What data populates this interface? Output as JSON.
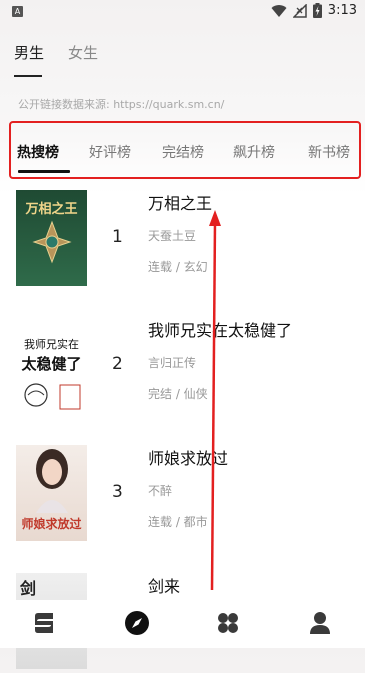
{
  "status": {
    "time": "3:13",
    "app_icon_letter": "A"
  },
  "gender_tabs": [
    {
      "label": "男生",
      "active": true
    },
    {
      "label": "女生",
      "active": false
    }
  ],
  "source_text": "公开链接数据来源: https://quark.sm.cn/",
  "rank_tabs": [
    {
      "label": "热搜榜",
      "active": true
    },
    {
      "label": "好评榜",
      "active": false
    },
    {
      "label": "完结榜",
      "active": false
    },
    {
      "label": "飙升榜",
      "active": false
    },
    {
      "label": "新书榜",
      "active": false
    }
  ],
  "books": [
    {
      "rank": "1",
      "title": "万相之王",
      "author": "天蚕土豆",
      "tags": "连载 / 玄幻",
      "cover_text": [
        "万相之王"
      ],
      "cover_colors": [
        "#1f4a33",
        "#2f6b4a"
      ]
    },
    {
      "rank": "2",
      "title": "我师兄实在太稳健了",
      "author": "言归正传",
      "tags": "完结 / 仙侠",
      "cover_text": [
        "我师兄实在",
        "太稳健了"
      ],
      "cover_colors": [
        "#ffffff",
        "#f4f4f4"
      ]
    },
    {
      "rank": "3",
      "title": "师娘求放过",
      "author": "不醉",
      "tags": "连载 / 都市",
      "cover_text": [
        "师娘求放过"
      ],
      "cover_colors": [
        "#f2ebe6",
        "#e8d9d0"
      ]
    },
    {
      "rank": "4",
      "title": "剑来",
      "author": "",
      "tags": "",
      "cover_text": [
        "剑"
      ],
      "cover_colors": [
        "#efefef",
        "#dcdcdc"
      ]
    }
  ],
  "bottom_nav": [
    {
      "icon": "bookshelf-icon",
      "active": false
    },
    {
      "icon": "compass-icon",
      "active": true
    },
    {
      "icon": "category-icon",
      "active": false
    },
    {
      "icon": "user-icon",
      "active": false
    }
  ],
  "colors": {
    "highlight_border": "#e32020",
    "arrow": "#e32020"
  }
}
